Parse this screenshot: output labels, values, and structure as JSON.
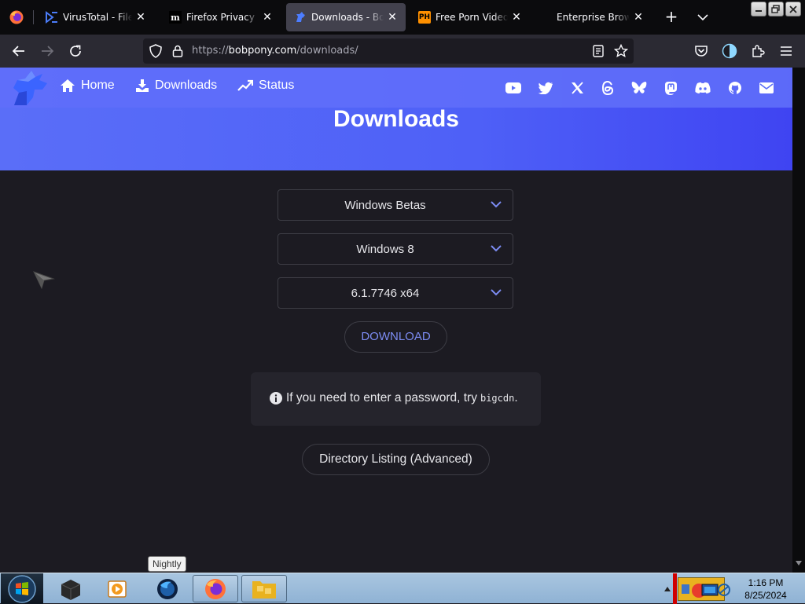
{
  "browser": {
    "tabs": [
      {
        "title": "VirusTotal - File - f",
        "favicon": "virustotal-icon",
        "active": false
      },
      {
        "title": "Firefox Privacy Not",
        "favicon": "mozilla-m-icon",
        "active": false
      },
      {
        "title": "Downloads - Bob P",
        "favicon": "bobpony-icon",
        "active": true
      },
      {
        "title": "Free Porn Videos &",
        "favicon": "ph-icon",
        "active": false
      },
      {
        "title": "Enterprise Browser",
        "favicon": "",
        "active": false
      }
    ],
    "favicon_ph_text": "PH",
    "favicon_m_text": "m",
    "url_prefix": "https://",
    "url_host": "bobpony.com",
    "url_path": "/downloads/"
  },
  "site": {
    "nav": {
      "home": "Home",
      "downloads": "Downloads",
      "status": "Status"
    },
    "social_icons": [
      "youtube-icon",
      "twitter-icon",
      "x-icon",
      "threads-icon",
      "bluesky-icon",
      "mastodon-icon",
      "discord-icon",
      "github-icon",
      "email-icon"
    ],
    "hero_title": "Downloads",
    "selects": {
      "category": "Windows Betas",
      "os": "Windows 8",
      "build": "6.1.7746 x64"
    },
    "download_label": "DOWNLOAD",
    "note": {
      "text": "If you need to enter a password, try",
      "code": "bigcdn",
      "end": "."
    },
    "directory_label": "Directory Listing (Advanced)"
  },
  "taskbar": {
    "tooltip": "Nightly",
    "time": "1:16 PM",
    "date": "8/25/2024"
  },
  "colors": {
    "accent": "#5a6ef8",
    "link_blue": "#7c8cf3",
    "page_bg": "#1c1b22"
  }
}
